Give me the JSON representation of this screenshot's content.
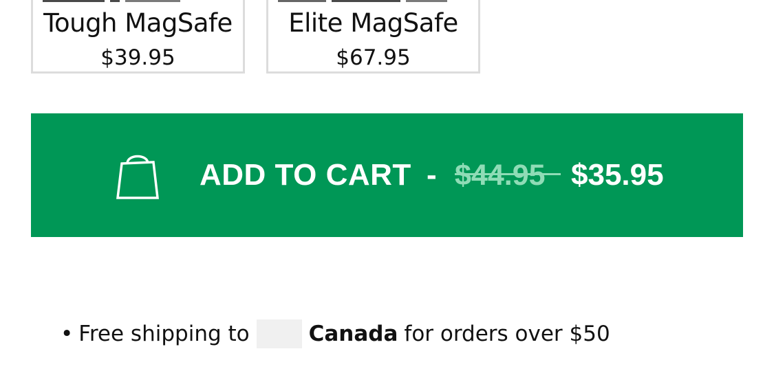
{
  "variants": [
    {
      "name": "Tough MagSafe",
      "price": "$39.95"
    },
    {
      "name": "Elite MagSafe",
      "price": "$67.95"
    }
  ],
  "add_to_cart": {
    "label": "ADD TO CART",
    "separator": "-",
    "original_price": "$44.95",
    "sale_price": "$35.95",
    "icon": "shopping-bag-icon",
    "background_color": "#009756",
    "strike_color": "#8fdcb6"
  },
  "shipping": {
    "bullet": "•",
    "prefix": "Free shipping to",
    "country": "Canada",
    "suffix": "for orders over $50",
    "flag_icon": "country-flag-icon"
  }
}
